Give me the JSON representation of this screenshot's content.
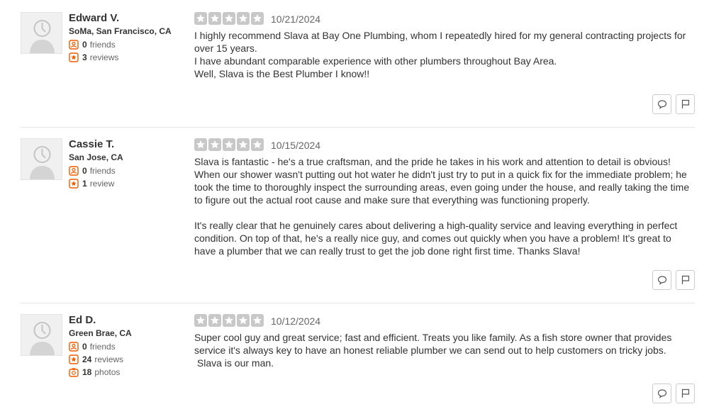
{
  "reviews": [
    {
      "name": "Edward V.",
      "location": "SoMa, San Francisco, CA",
      "friends_count": "0",
      "friends_label": "friends",
      "reviews_count": "3",
      "reviews_label": "reviews",
      "rating": 5,
      "date": "10/21/2024",
      "paragraphs": [
        "I highly recommend Slava at Bay One Plumbing, whom I  repeatedly hired for my general contracting projects for over 15 years.",
        "I have abundant comparable experience with other plumbers throughout Bay Area.",
        "Well, Slava is the Best Plumber I know!!"
      ]
    },
    {
      "name": "Cassie T.",
      "location": "San Jose, CA",
      "friends_count": "0",
      "friends_label": "friends",
      "reviews_count": "1",
      "reviews_label": "review",
      "rating": 5,
      "date": "10/15/2024",
      "paragraphs": [
        "Slava is fantastic - he's a true craftsman, and the pride he takes in his work and attention to detail is obvious! When our shower wasn't putting out hot water he didn't just try to put in a quick fix for the immediate problem; he took the time to thoroughly inspect the surrounding areas, even going under the house, and really taking the time to figure out the actual root cause and make sure that everything was functioning properly.",
        "It's really clear that he genuinely cares about delivering a high-quality service and leaving everything in perfect condition. On top of that, he's a really nice guy, and comes out quickly when you have a problem! It's great to have a plumber that we can really trust to get the job done right first time. Thanks Slava!"
      ]
    },
    {
      "name": "Ed D.",
      "location": "Green Brae, CA",
      "friends_count": "0",
      "friends_label": "friends",
      "reviews_count": "24",
      "reviews_label": "reviews",
      "photos_count": "18",
      "photos_label": "photos",
      "rating": 5,
      "date": "10/12/2024",
      "paragraphs": [
        "Super cool guy and great service; fast and efficient. Treats you like family. As a fish store owner that provides service it's always key to have an honest reliable plumber we can send out to help customers on tricky jobs.",
        " Slava is our man."
      ]
    }
  ],
  "colors": {
    "star_empty": "#c8c8c8",
    "stat_icon": "#f15c00"
  },
  "icons": {
    "avatar": "default-avatar-icon",
    "friends": "friends-icon",
    "reviews": "review-star-icon",
    "photos": "camera-icon",
    "comment": "comment-icon",
    "flag": "flag-icon"
  }
}
